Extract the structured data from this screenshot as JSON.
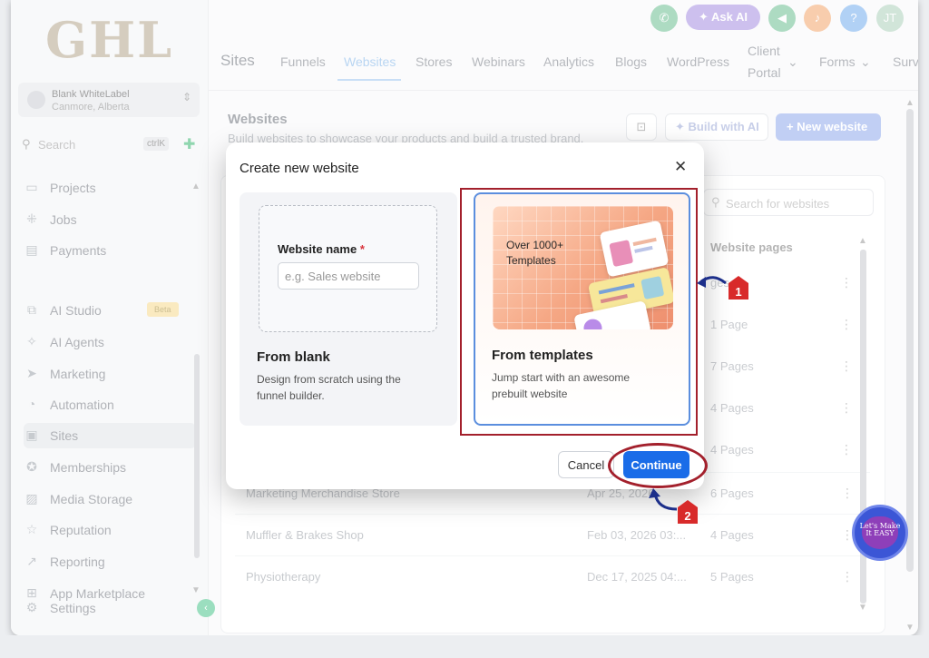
{
  "sidebar": {
    "logo": "GHL",
    "account": {
      "name": "Blank WhiteLabel",
      "location": "Canmore, Alberta"
    },
    "search": {
      "label": "Search",
      "shortcut": "ctrlK"
    },
    "items": [
      {
        "label": "Projects",
        "icon": "folder-icon"
      },
      {
        "label": "Jobs",
        "icon": "grid-icon"
      },
      {
        "label": "Payments",
        "icon": "receipt-icon"
      },
      {
        "label": "AI Studio",
        "icon": "ai-icon",
        "badge": "Beta"
      },
      {
        "label": "AI Agents",
        "icon": "sparkle-icon"
      },
      {
        "label": "Marketing",
        "icon": "send-icon"
      },
      {
        "label": "Automation",
        "icon": "automation-icon"
      },
      {
        "label": "Sites",
        "icon": "browser-icon"
      },
      {
        "label": "Memberships",
        "icon": "badge-icon"
      },
      {
        "label": "Media Storage",
        "icon": "image-icon"
      },
      {
        "label": "Reputation",
        "icon": "star-icon"
      },
      {
        "label": "Reporting",
        "icon": "chart-icon"
      },
      {
        "label": "App Marketplace",
        "icon": "apps-icon"
      },
      {
        "label": "Settings",
        "icon": "gear-icon"
      }
    ]
  },
  "topbar": {
    "ask_ai": "Ask AI",
    "avatar_initials": "JT",
    "help": "?",
    "colors": {
      "green": "#2fa566",
      "purple": "#6a4bd0",
      "orange": "#f0822e",
      "blue": "#3a8de8",
      "avatar": "#8bbf9f"
    }
  },
  "nav": {
    "section": "Sites",
    "tabs": [
      "Funnels",
      "Websites",
      "Stores",
      "Webinars",
      "Analytics",
      "Blogs",
      "WordPress",
      "Client",
      "Portal",
      "Forms",
      "Surv"
    ]
  },
  "page": {
    "title": "Websites",
    "subtitle": "Build websites to showcase your products and build a trusted brand.",
    "build_ai": "Build with AI",
    "new_website": "New website",
    "search_placeholder": "Search for websites",
    "col_pages": "Website pages"
  },
  "table": {
    "rows": [
      {
        "name": "",
        "date": "",
        "pages": "1 Page"
      },
      {
        "name": "",
        "date": "",
        "pages": "7 Pages"
      },
      {
        "name": "",
        "date": "",
        "pages": "4 Pages"
      },
      {
        "name": "",
        "date": "",
        "pages": "4 Pages"
      },
      {
        "name": "Marketing Merchandise Store",
        "date": "Apr 25, 2026",
        "pages": "6 Pages"
      },
      {
        "name": "Muffler & Brakes Shop",
        "date": "Feb 03, 2026 03:...",
        "pages": "4 Pages"
      },
      {
        "name": "Physiotherapy",
        "date": "Dec 17, 2025 04:...",
        "pages": "5 Pages"
      }
    ],
    "partial_pages": "ges"
  },
  "modal": {
    "title": "Create new website",
    "blank": {
      "field_label": "Website name",
      "required_mark": "*",
      "placeholder": "e.g. Sales website",
      "title": "From blank",
      "desc": "Design from scratch using the funnel builder."
    },
    "templates": {
      "image_text": "Over 1000+ Templates",
      "title": "From templates",
      "desc": "Jump start with an awesome prebuilt website"
    },
    "cancel": "Cancel",
    "continue": "Continue"
  },
  "annotations": {
    "marker_1": "1",
    "marker_2": "2",
    "highlight_color": "#a3202c",
    "marker_color": "#d82a2a"
  },
  "watermark": {
    "text": "Let's Make It EASY"
  }
}
